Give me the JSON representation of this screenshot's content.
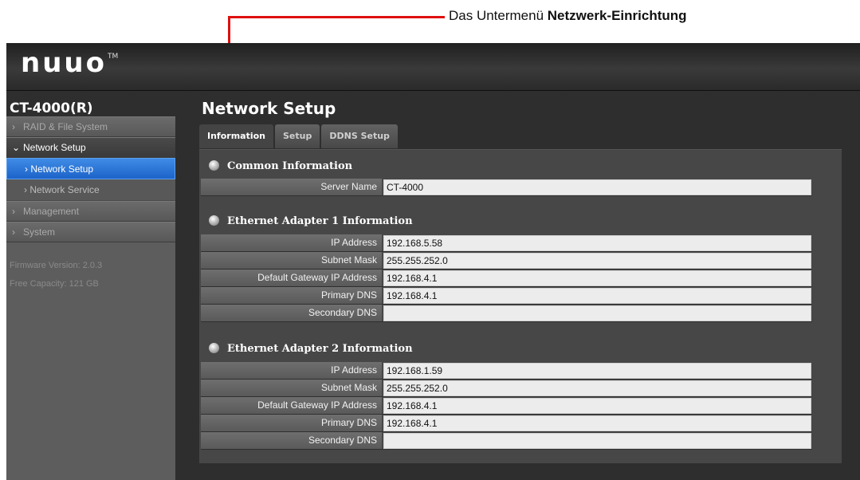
{
  "annotation": {
    "text_prefix": "Das Untermenü ",
    "text_bold": "Netzwerk-Einrichtung"
  },
  "header": {
    "logo": "nuuo",
    "tm": "TM"
  },
  "sidebar": {
    "device": "CT-4000(R)",
    "items": [
      {
        "label": "RAID & File System",
        "chevron": "›"
      },
      {
        "label": "Network Setup",
        "chevron": "⌄",
        "expanded": true,
        "children": [
          {
            "label": "Network Setup",
            "prefix": "›",
            "active": true
          },
          {
            "label": "Network Service",
            "prefix": "›"
          }
        ]
      },
      {
        "label": "Management",
        "chevron": "›"
      },
      {
        "label": "System",
        "chevron": "›"
      }
    ],
    "firmware": "Firmware Version: 2.0.3",
    "capacity": "Free Capacity: 121 GB"
  },
  "main": {
    "title": "Network Setup",
    "tabs": [
      "Information",
      "Setup",
      "DDNS Setup"
    ],
    "active_tab": "Information",
    "sections": [
      {
        "title": "Common Information",
        "rows": [
          {
            "label": "Server Name",
            "value": "CT-4000"
          }
        ]
      },
      {
        "title": "Ethernet Adapter 1 Information",
        "rows": [
          {
            "label": "IP Address",
            "value": "192.168.5.58"
          },
          {
            "label": "Subnet Mask",
            "value": "255.255.252.0"
          },
          {
            "label": "Default Gateway IP Address",
            "value": "192.168.4.1"
          },
          {
            "label": "Primary DNS",
            "value": "192.168.4.1"
          },
          {
            "label": "Secondary DNS",
            "value": ""
          }
        ]
      },
      {
        "title": "Ethernet Adapter 2 Information",
        "rows": [
          {
            "label": "IP Address",
            "value": "192.168.1.59"
          },
          {
            "label": "Subnet Mask",
            "value": "255.255.252.0"
          },
          {
            "label": "Default Gateway IP Address",
            "value": "192.168.4.1"
          },
          {
            "label": "Primary DNS",
            "value": "192.168.4.1"
          },
          {
            "label": "Secondary DNS",
            "value": ""
          }
        ]
      }
    ]
  },
  "colors": {
    "accent_active": "#2a74d9",
    "annotation_red": "#e01010",
    "background_dark": "#2e2e2e"
  }
}
